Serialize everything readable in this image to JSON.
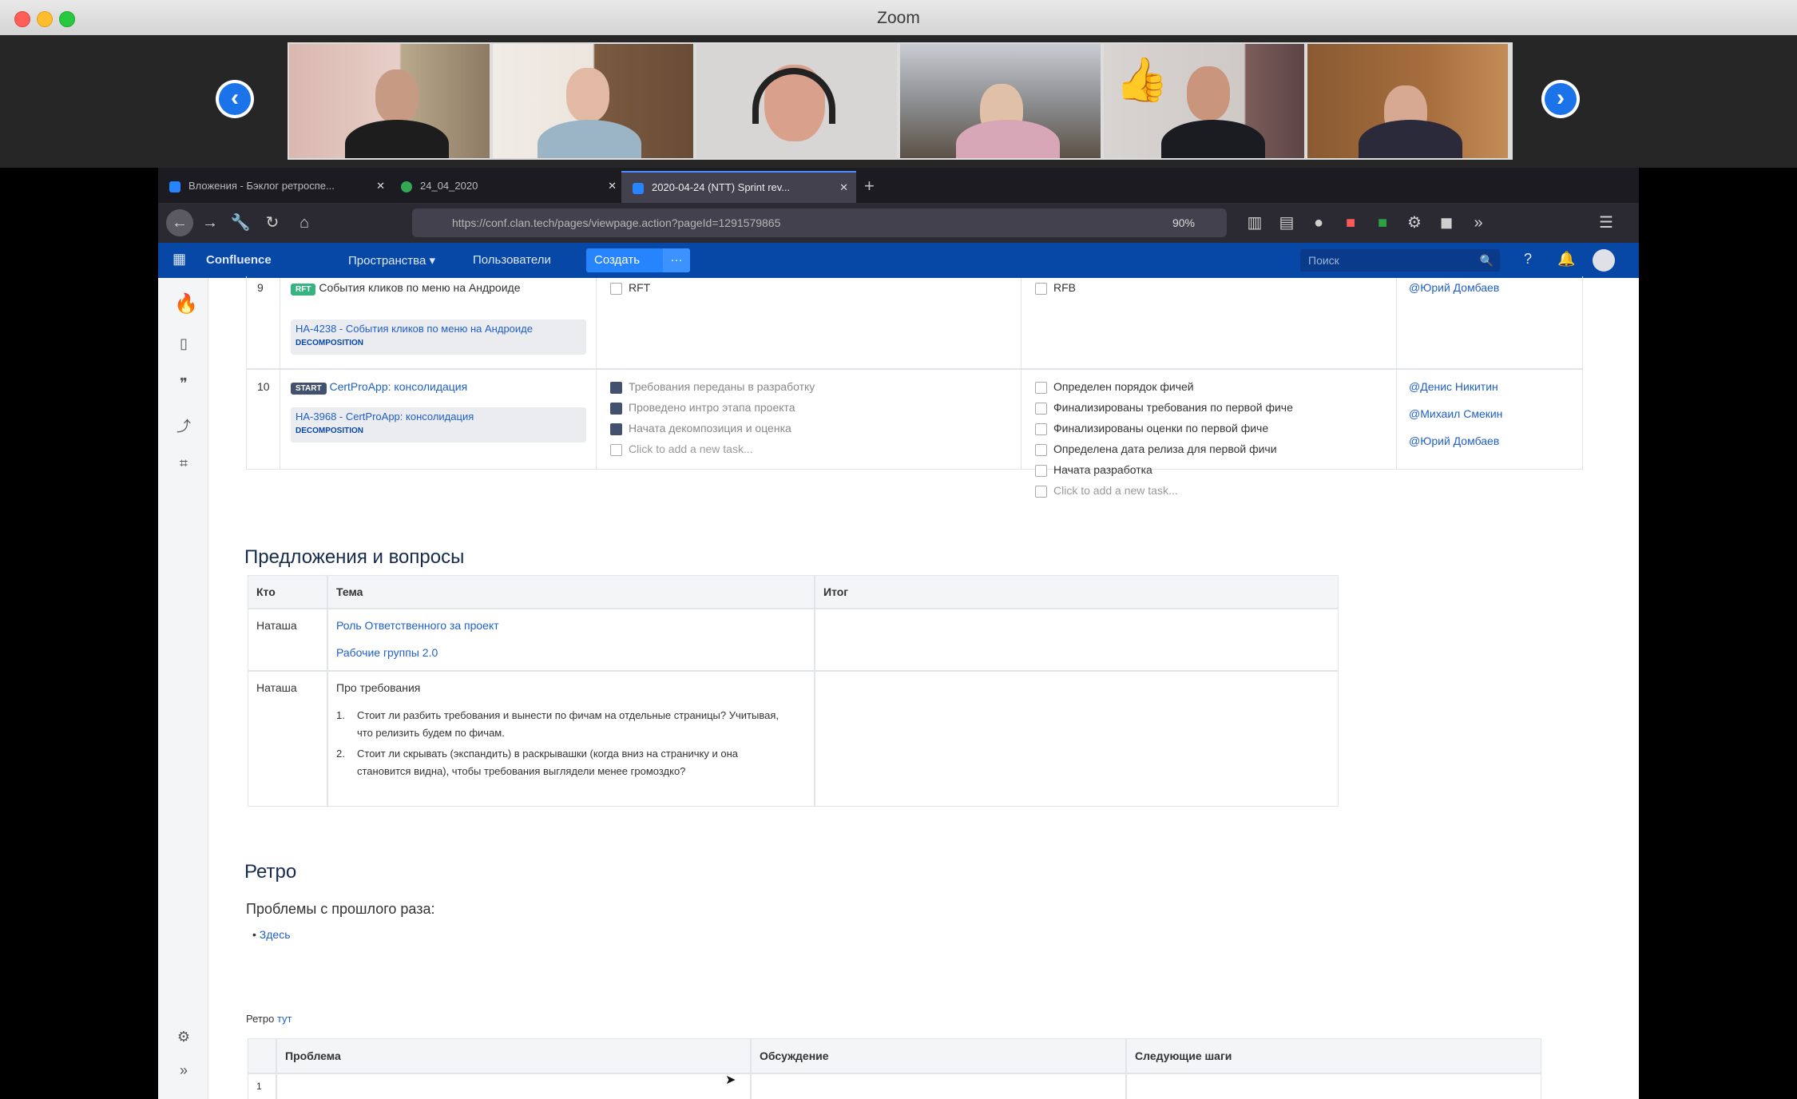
{
  "window": {
    "title": "Zoom"
  },
  "gallery": {
    "participants": [
      "participant-1",
      "participant-2",
      "participant-3",
      "participant-4",
      "participant-5",
      "participant-6"
    ],
    "reaction": "👍"
  },
  "browser": {
    "tabs": [
      {
        "label": "Вложения - Бэклог ретроспе..."
      },
      {
        "label": "24_04_2020"
      },
      {
        "label": "2020-04-24 (NTT) Sprint rev..."
      }
    ],
    "url": "https://conf.clan.tech/pages/viewpage.action?pageId=1291579865",
    "zoom": "90%"
  },
  "confluence": {
    "logo_text": "Confluence",
    "nav": {
      "spaces": "Пространства",
      "people": "Пользователи",
      "create": "Создать",
      "more": "···"
    },
    "search_placeholder": "Поиск",
    "rows": [
      {
        "num": "9",
        "lozenge": "RFT",
        "title": "События кликов по меню на Андроиде",
        "issue": "HA-4238 - События кликов по меню на Андроиде",
        "issue_status": "DECOMPOSITION",
        "done": "RFT",
        "next": "RFB",
        "owner": "@Юрий Домбаев"
      },
      {
        "num": "10",
        "lozenge": "START",
        "title": "CertProApp: консолидация",
        "issue": "HA-3968 - CertProApp: консолидация",
        "issue_status": "DECOMPOSITION",
        "done_items": [
          {
            "text": "Требования переданы в разработку",
            "checked": true
          },
          {
            "text": "Проведено интро этапа проекта",
            "checked": true
          },
          {
            "text": "Начата декомпозиция и оценка",
            "checked": true
          },
          {
            "text": "Click to add a new task...",
            "checked": false
          }
        ],
        "next_items": [
          "Определен порядок фичей",
          "Финализированы требования по первой фиче",
          "Финализированы оценки по первой фиче",
          "Определена дата релиза для первой фичи",
          "Начата разработка",
          "Click to add a new task..."
        ],
        "owners": [
          "@Денис Никитин",
          "@Михаил Смекин",
          "@Юрий Домбаев"
        ]
      }
    ],
    "section1": {
      "heading": "Предложения и вопросы",
      "headers": [
        "Кто",
        "Тема",
        "Итог"
      ],
      "r1_who": "Наташа",
      "r1_topics": [
        "Роль Ответственного за проект",
        "Рабочие группы 2.0"
      ],
      "r2_who": "Наташа",
      "r2_topic": "Про требования",
      "r2_items": [
        "Стоит ли разбить требования и вынести по фичам на отдельные страницы? Учитывая, что релизить будем по фичам.",
        "Стоит ли скрывать (экспандить) в раскрывашки (когда вниз на страничку и она становится видна), чтобы требования выглядели менее громоздко?"
      ]
    },
    "section2": {
      "heading": "Ретро",
      "subheading": "Проблемы с прошлого раза:",
      "bullet": "Здесь",
      "retro_label": "Ретро",
      "retro_link": "тут",
      "headers": [
        "Проблема",
        "Обсуждение",
        "Следующие шаги"
      ],
      "first_row_num": "1"
    }
  }
}
